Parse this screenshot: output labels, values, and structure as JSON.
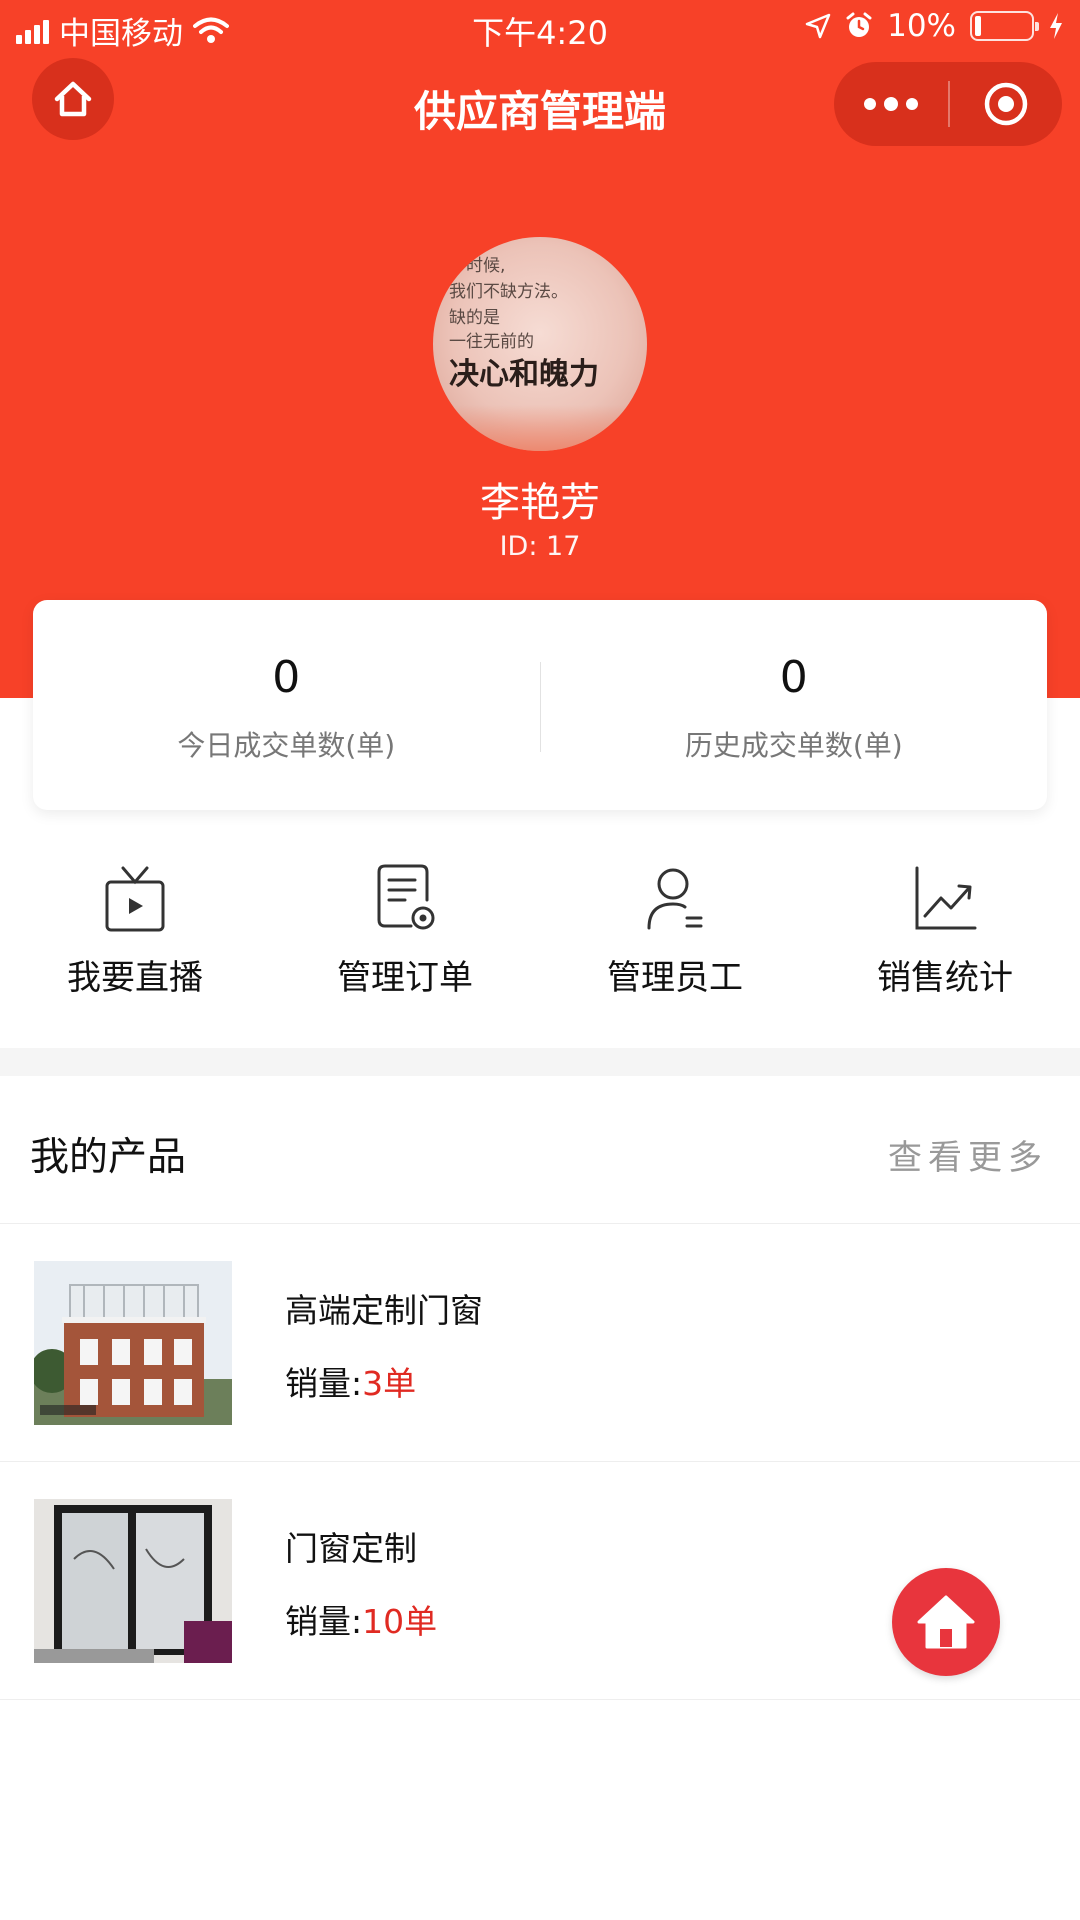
{
  "status_bar": {
    "carrier": "中国移动",
    "time": "下午4:20",
    "battery": "10%"
  },
  "nav": {
    "title": "供应商管理端"
  },
  "profile": {
    "avatar_lines": [
      "多时候,",
      "我们不缺方法。",
      "缺的是",
      "一往无前的"
    ],
    "avatar_big": "决心和魄力",
    "name": "李艳芳",
    "id_text": "ID: 17"
  },
  "stats": [
    {
      "value": "0",
      "label": "今日成交单数(单)"
    },
    {
      "value": "0",
      "label": "历史成交单数(单)"
    }
  ],
  "menu": [
    {
      "label": "我要直播",
      "icon": "live-tv-icon"
    },
    {
      "label": "管理订单",
      "icon": "order-settings-icon"
    },
    {
      "label": "管理员工",
      "icon": "staff-icon"
    },
    {
      "label": "销售统计",
      "icon": "sales-chart-icon"
    }
  ],
  "products_section": {
    "title": "我的产品",
    "more": "查看更多"
  },
  "products": [
    {
      "name": "高端定制门窗",
      "sales_label": "销量:",
      "sales_value": "3单"
    },
    {
      "name": "门窗定制",
      "sales_label": "销量:",
      "sales_value": "10单"
    }
  ],
  "colors": {
    "brand_red": "#f74128",
    "accent_red": "#e02a22",
    "fab_red": "#e8353d"
  }
}
